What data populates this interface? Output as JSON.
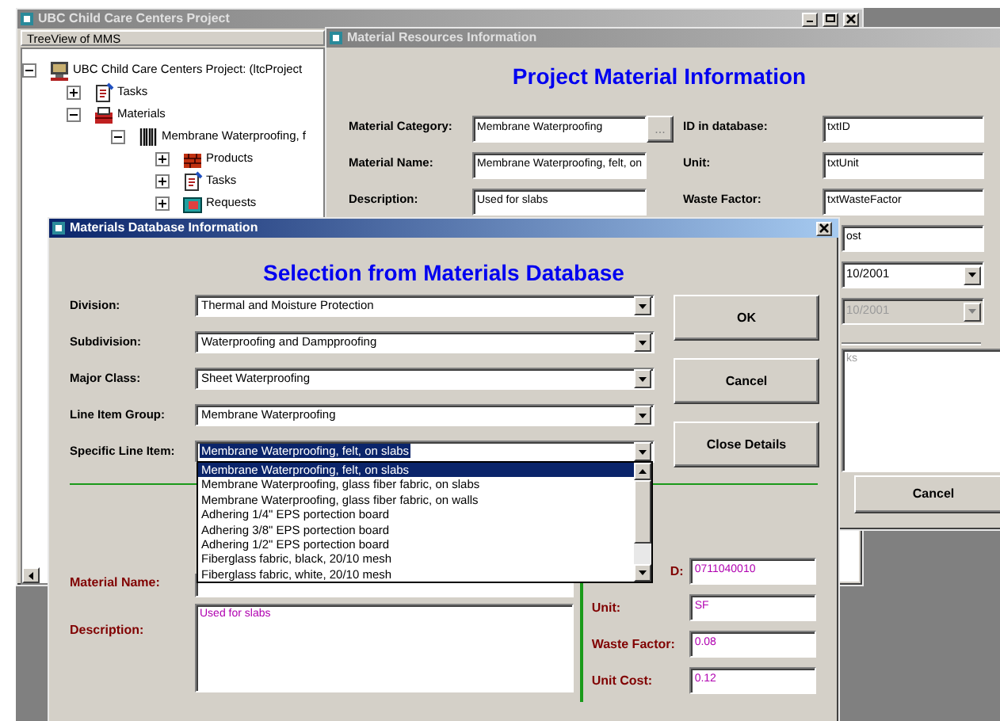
{
  "main_window": {
    "title": "UBC Child Care Centers Project",
    "tree_header": "TreeView of MMS",
    "tree": [
      {
        "label": "UBC Child Care Centers Project: (ltcProject",
        "kind": "project",
        "expanded": true,
        "children": [
          {
            "label": "Tasks",
            "kind": "tasks",
            "expanded": false
          },
          {
            "label": "Materials",
            "kind": "materials",
            "expanded": true,
            "children": [
              {
                "label": "Membrane Waterproofing, f",
                "kind": "material",
                "expanded": true,
                "children": [
                  {
                    "label": "Products",
                    "kind": "products",
                    "expanded": false
                  },
                  {
                    "label": "Tasks",
                    "kind": "tasks",
                    "expanded": false
                  },
                  {
                    "label": "Requests",
                    "kind": "requests",
                    "expanded": false
                  }
                ]
              }
            ]
          }
        ]
      }
    ]
  },
  "resources_window": {
    "title": "Material Resources Information",
    "heading": "Project Material Information",
    "left_fields": [
      {
        "label": "Material Category:",
        "value": "Membrane Waterproofing",
        "browse": "..."
      },
      {
        "label": "Material Name:",
        "value": "Membrane Waterproofing, felt, on"
      },
      {
        "label": "Description:",
        "value": "Used for slabs"
      }
    ],
    "right_fields": [
      {
        "kind": "text",
        "label": "ID in database:",
        "value": "txtID"
      },
      {
        "kind": "text",
        "label": "Unit:",
        "value": "txtUnit"
      },
      {
        "kind": "text",
        "label": "Waste Factor:",
        "value": "txtWasteFactor"
      },
      {
        "kind": "text",
        "value": "ost"
      },
      {
        "kind": "combo",
        "value": "10/2001",
        "disabled": false
      },
      {
        "kind": "combo",
        "value": "10/2001",
        "disabled": true
      }
    ],
    "remarks": "ks",
    "cancel_button": "Cancel"
  },
  "database_dialog": {
    "title": "Materials Database Information",
    "heading": "Selection from Materials Database",
    "selectors": [
      {
        "label": "Division:",
        "value": "Thermal and Moisture Protection",
        "open": false
      },
      {
        "label": "Subdivision:",
        "value": "Waterproofing and Dampproofing",
        "open": false
      },
      {
        "label": "Major Class:",
        "value": "Sheet Waterproofing",
        "open": false
      },
      {
        "label": "Line Item Group:",
        "value": "Membrane Waterproofing",
        "open": false
      },
      {
        "label": "Specific Line Item:",
        "value": "Membrane Waterproofing, felt, on slabs",
        "open": true
      }
    ],
    "dropdown_items": [
      {
        "text": "Membrane Waterproofing, felt, on slabs",
        "selected": true
      },
      {
        "text": "Membrane Waterproofing, glass fiber fabric, on slabs",
        "selected": false
      },
      {
        "text": "Membrane Waterproofing, glass fiber fabric, on walls",
        "selected": false
      },
      {
        "text": "Adhering 1/4\" EPS portection board",
        "selected": false
      },
      {
        "text": "Adhering 3/8\" EPS portection board",
        "selected": false
      },
      {
        "text": "Adhering 1/2\" EPS portection board",
        "selected": false
      },
      {
        "text": "Fiberglass fabric, black, 20/10 mesh",
        "selected": false
      },
      {
        "text": "Fiberglass fabric, white, 20/10 mesh",
        "selected": false
      }
    ],
    "buttons": [
      "OK",
      "Cancel",
      "Close Details"
    ],
    "details_left": [
      {
        "label": "Material Name:",
        "kind": "line"
      },
      {
        "label": "Description:",
        "kind": "area",
        "value": "Used for slabs"
      }
    ],
    "details_right": [
      {
        "label": "D:",
        "value": "0711040010"
      },
      {
        "label": "Unit:",
        "value": "SF"
      },
      {
        "label": "Waste Factor:",
        "value": "0.08"
      },
      {
        "label": "Unit Cost:",
        "value": "0.12"
      }
    ]
  }
}
